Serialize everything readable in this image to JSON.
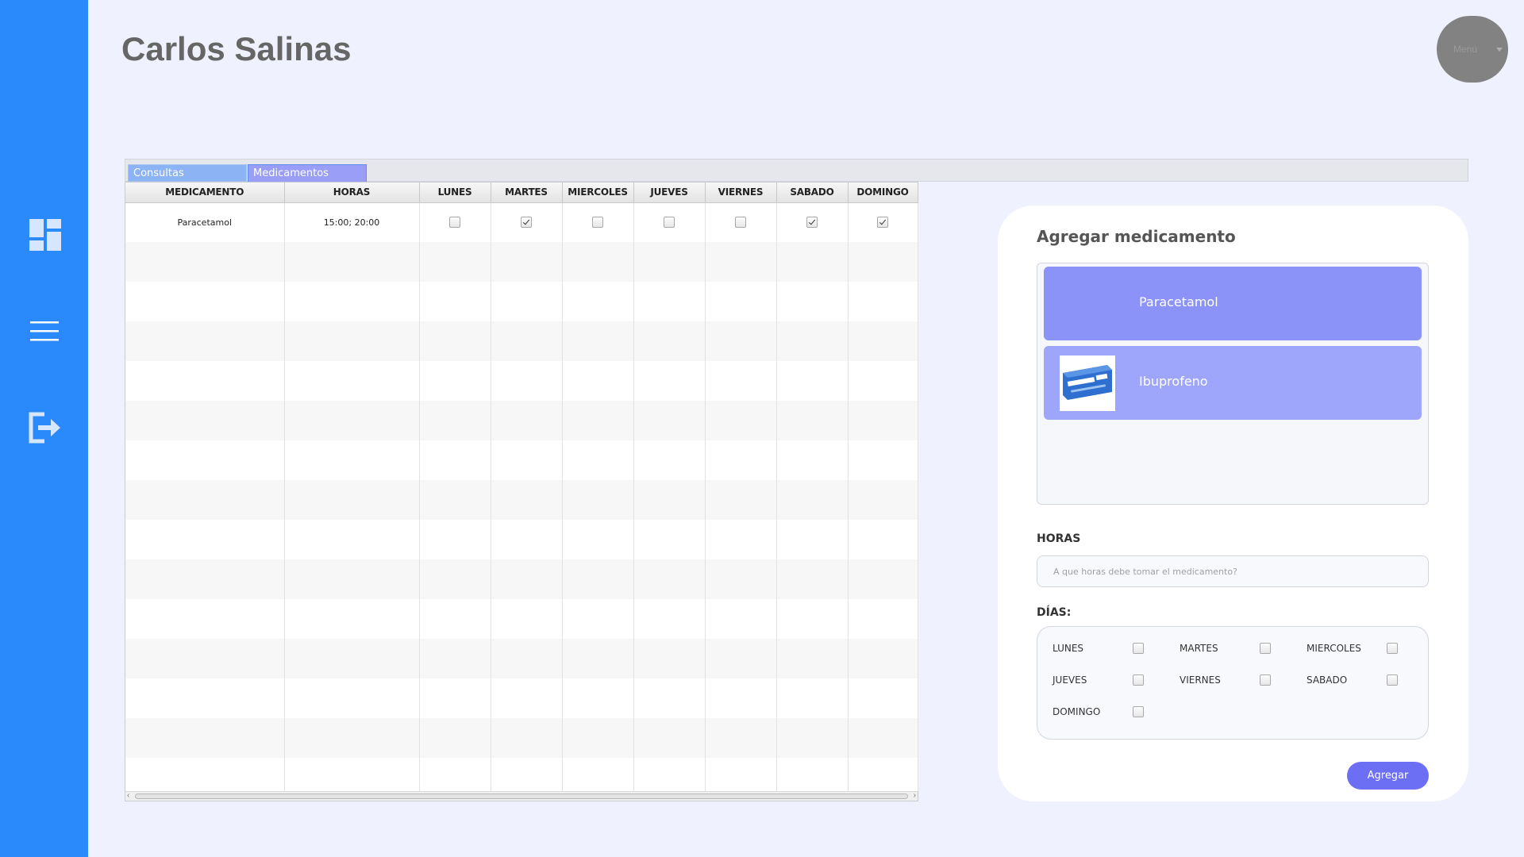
{
  "header": {
    "user_name": "Carlos Salinas",
    "menu_label": "Menú"
  },
  "sidebar": {
    "items": [
      {
        "icon": "dashboard-icon"
      },
      {
        "icon": "hamburger-menu-icon"
      },
      {
        "icon": "logout-icon"
      }
    ]
  },
  "tabs": [
    {
      "label": "Consultas",
      "selected": false
    },
    {
      "label": "Medicamentos",
      "selected": true
    }
  ],
  "table": {
    "columns": [
      "MEDICAMENTO",
      "HORAS",
      "LUNES",
      "MARTES",
      "MIERCOLES",
      "JUEVES",
      "VIERNES",
      "SABADO",
      "DOMINGO"
    ],
    "rows": [
      {
        "medicamento": "Paracetamol",
        "horas": "15:00; 20:00",
        "days": [
          false,
          true,
          false,
          false,
          false,
          true,
          true
        ]
      }
    ]
  },
  "form": {
    "title": "Agregar medicamento",
    "medications": [
      {
        "name": "Paracetamol",
        "has_image": false
      },
      {
        "name": "Ibuprofeno",
        "has_image": true
      }
    ],
    "hours_label": "HORAS",
    "hours_placeholder": "A que horas debe tomar el medicamento?",
    "days_label": "DÍAS:",
    "days": [
      {
        "label": "LUNES",
        "checked": false
      },
      {
        "label": "MARTES",
        "checked": false
      },
      {
        "label": "MIERCOLES",
        "checked": false
      },
      {
        "label": "JUEVES",
        "checked": false
      },
      {
        "label": "VIERNES",
        "checked": false
      },
      {
        "label": "SABADO",
        "checked": false
      },
      {
        "label": "DOMINGO",
        "checked": false
      }
    ],
    "submit_label": "Agregar"
  },
  "colors": {
    "sidebar": "#2a8afc",
    "background": "#eff2fe",
    "med_item_primary": "#8b93f8",
    "med_item_secondary": "#9ea6fb",
    "button": "#6c6ff3"
  }
}
